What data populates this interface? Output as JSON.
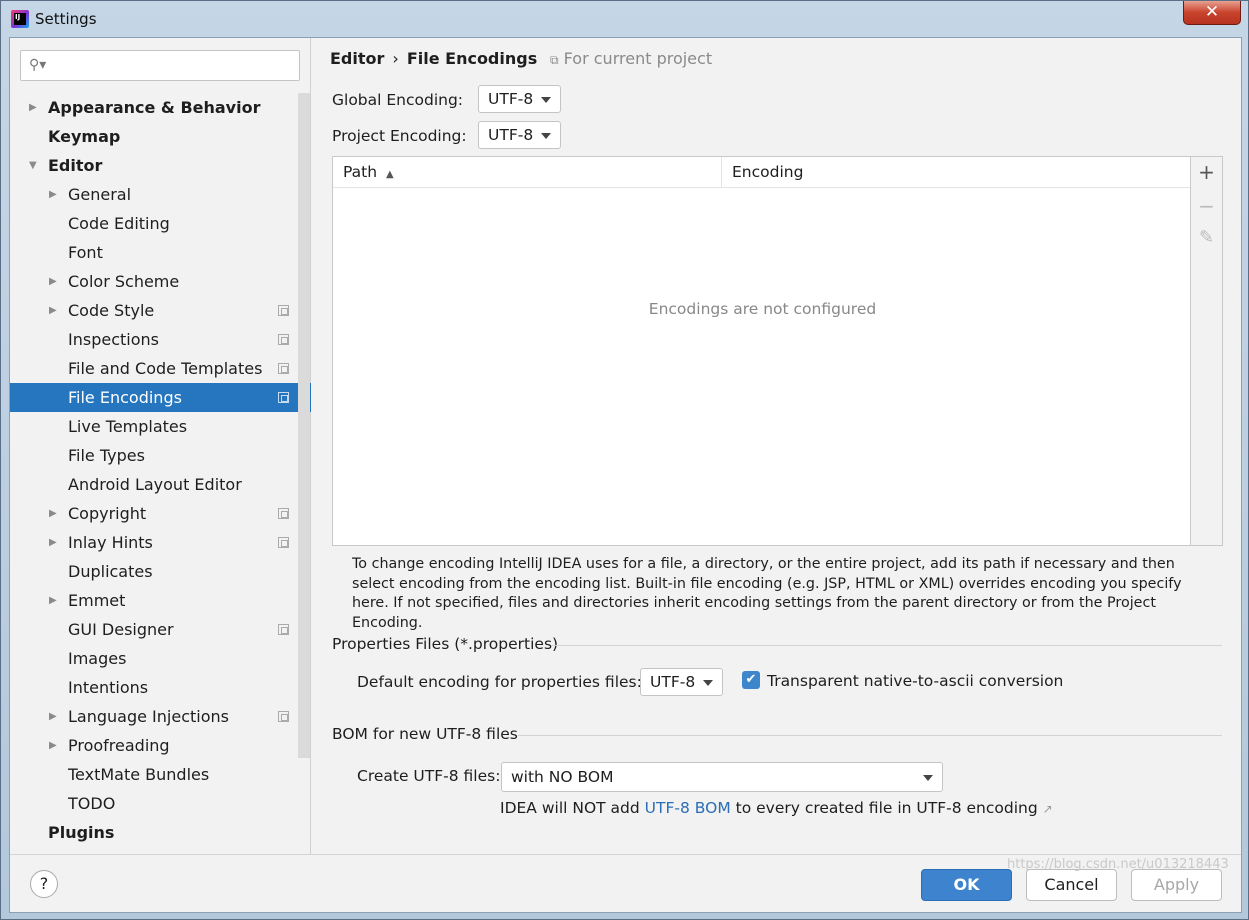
{
  "window": {
    "title": "Settings",
    "close_glyph": "✕"
  },
  "search": {
    "placeholder": "",
    "icon": "search-icon"
  },
  "sidebar": {
    "items": [
      {
        "label": "Appearance & Behavior",
        "level": 0,
        "expandable": true,
        "expanded": false
      },
      {
        "label": "Keymap",
        "level": 0,
        "expandable": false
      },
      {
        "label": "Editor",
        "level": 0,
        "expandable": true,
        "expanded": true
      },
      {
        "label": "General",
        "level": 1,
        "expandable": true
      },
      {
        "label": "Code Editing",
        "level": 1,
        "expandable": false
      },
      {
        "label": "Font",
        "level": 1,
        "expandable": false
      },
      {
        "label": "Color Scheme",
        "level": 1,
        "expandable": true
      },
      {
        "label": "Code Style",
        "level": 1,
        "expandable": true,
        "project": true
      },
      {
        "label": "Inspections",
        "level": 1,
        "expandable": false,
        "project": true
      },
      {
        "label": "File and Code Templates",
        "level": 1,
        "expandable": false,
        "project": true
      },
      {
        "label": "File Encodings",
        "level": 1,
        "expandable": false,
        "project": true,
        "selected": true
      },
      {
        "label": "Live Templates",
        "level": 1,
        "expandable": false
      },
      {
        "label": "File Types",
        "level": 1,
        "expandable": false
      },
      {
        "label": "Android Layout Editor",
        "level": 1,
        "expandable": false
      },
      {
        "label": "Copyright",
        "level": 1,
        "expandable": true,
        "project": true
      },
      {
        "label": "Inlay Hints",
        "level": 1,
        "expandable": true,
        "project": true
      },
      {
        "label": "Duplicates",
        "level": 1,
        "expandable": false
      },
      {
        "label": "Emmet",
        "level": 1,
        "expandable": true
      },
      {
        "label": "GUI Designer",
        "level": 1,
        "expandable": false,
        "project": true
      },
      {
        "label": "Images",
        "level": 1,
        "expandable": false
      },
      {
        "label": "Intentions",
        "level": 1,
        "expandable": false
      },
      {
        "label": "Language Injections",
        "level": 1,
        "expandable": true,
        "project": true
      },
      {
        "label": "Proofreading",
        "level": 1,
        "expandable": true
      },
      {
        "label": "TextMate Bundles",
        "level": 1,
        "expandable": false
      },
      {
        "label": "TODO",
        "level": 1,
        "expandable": false
      },
      {
        "label": "Plugins",
        "level": 0,
        "expandable": false
      }
    ]
  },
  "breadcrumb": {
    "parent": "Editor",
    "separator": "›",
    "current": "File Encodings"
  },
  "scope_note": "For current project",
  "global_encoding": {
    "label": "Global Encoding:",
    "value": "UTF-8"
  },
  "project_encoding": {
    "label": "Project Encoding:",
    "value": "UTF-8"
  },
  "table": {
    "columns": [
      "Path",
      "Encoding"
    ],
    "sort_indicator": "▲",
    "empty_message": "Encodings are not configured",
    "tools": {
      "add": "+",
      "remove": "−",
      "edit": "✎"
    }
  },
  "help_text": "To change encoding IntelliJ IDEA uses for a file, a directory, or the entire project, add its path if necessary and then select encoding from the encoding list. Built-in file encoding (e.g. JSP, HTML or XML) overrides encoding you specify here. If not specified, files and directories inherit encoding settings from the parent directory or from the Project Encoding.",
  "properties": {
    "title": "Properties Files (*.properties)",
    "default_label": "Default encoding for properties files:",
    "default_value": "UTF-8",
    "checkbox_checked": true,
    "checkbox_label": "Transparent native-to-ascii conversion"
  },
  "bom": {
    "title": "BOM for new UTF-8 files",
    "create_label": "Create UTF-8 files:",
    "create_value": "with NO BOM",
    "note_prefix": "IDEA will NOT add ",
    "note_link": "UTF-8 BOM",
    "note_suffix": " to every created file in UTF-8 encoding",
    "note_arrow": "↗"
  },
  "footer": {
    "help": "?",
    "ok": "OK",
    "cancel": "Cancel",
    "apply": "Apply"
  },
  "watermark": "https://blog.csdn.net/u013218443"
}
